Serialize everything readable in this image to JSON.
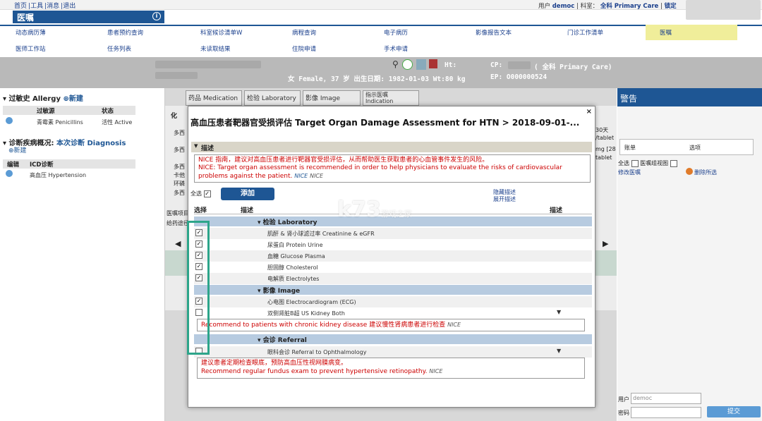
{
  "top": {
    "links": [
      "首页",
      "工具",
      "消息",
      "退出"
    ],
    "user_label": "用户",
    "user": "democ",
    "dept_label": "科室：",
    "dept": "全科 Primary Care",
    "lock": "锁定"
  },
  "app_title": "医嘱",
  "menu": {
    "row1": [
      "动态病历薄",
      "患者预约查询",
      "科室候诊清单W",
      "病程查询",
      "电子病历",
      "影像报告文本",
      "门诊工作清单",
      "医嘱"
    ],
    "row2": [
      "医师工作站",
      "任务列表",
      "未读取结果",
      "住院申请",
      "手术申请"
    ]
  },
  "patient": {
    "ht": "Ht:",
    "cp": "CP:",
    "care": "( 全科 Primary Care)",
    "line2": "女 Female, 37 岁  出生日期: 1982-01-03  Wt:80 kg",
    "ep": "EP: O000000524"
  },
  "left": {
    "allergy_title": "过敏史 Allergy",
    "new": "新建",
    "allergy_cols": [
      "过敏源",
      "状态"
    ],
    "allergy_row": [
      "青霉素 Penicillins",
      "活性 Active"
    ],
    "diag_title": "诊断疾病概况:",
    "diag_title2": "本次诊断 Diagnosis",
    "diag_cols": [
      "编辑",
      "ICD诊断"
    ],
    "diag_row": "高血压 Hypertension"
  },
  "tabs": [
    "药品 Medication",
    "检验 Laboratory",
    "影像 Image",
    "指示医嘱 Indication"
  ],
  "bg_fragments": {
    "a": "多西",
    "b": "医嘱项目",
    "c": "给药途径",
    "d": "卡他",
    "e": "环磷",
    "f": "30天",
    "g": "/tablet",
    "h": "mg [28",
    "i": "tablet",
    "j": "化"
  },
  "modal": {
    "title": "高血压患者靶器官受损评估 Target Organ Damage Assessment for HTN > 2018-09-01-...",
    "close": "×",
    "desc_label": "描述",
    "desc_zh": "NICE 指南，建议对高血压患者进行靶器官受损评估，从而帮助医生获取患者的心血管事件发生的风险。",
    "desc_en": "NICE: Target organ assessment is recommended in order to help physicians to evaluate the risks of cardiovascular problems against the patient.",
    "desc_nice": "NICE",
    "desc_nice2": "NICE",
    "select_all": "全选",
    "add": "添加",
    "hide": "隐藏描述",
    "expand": "展开描述",
    "col_select": "选择",
    "col_desc": "描述",
    "col_desc2": "描述",
    "cat_lab": "检验 Laboratory",
    "lab_items": [
      "肌酐 & 肾小球滤过率 Creatinine & eGFR",
      "尿蛋白 Protein Urine",
      "血糖 Glucose Plasma",
      "胆固醇 Cholesterol",
      "电解质 Electrolytes"
    ],
    "cat_img": "影像 Image",
    "img_items": [
      "心电图 Electrocardiogram (ECG)",
      "双侧肾脏B超 US Kidney Both"
    ],
    "img_note": "Recommend to patients with chronic kidney disease 建议慢性肾病患者进行检查",
    "img_note_nice": "NICE",
    "cat_ref": "会诊 Referral",
    "ref_items": [
      "眼科会诊 Referral to Ophthalmology"
    ],
    "ref_note_zh": "建议患者定期检查眼底，预防高血压性视网膜病变。",
    "ref_note_en": "Recommend regular fundus exam to prevent hypertensive retinopathy.",
    "ref_note_nice": "NICE"
  },
  "right": {
    "title": "警告",
    "cols": [
      "账单",
      "选项"
    ],
    "select_all": "全选",
    "checkbox_label": "医嘱组视图",
    "edit": "修改医嘱",
    "delete": "删除所选",
    "user_label": "用户",
    "user_val": "democ",
    "pwd_label": "密码",
    "submit": "提交"
  },
  "watermark": {
    "main": "k73",
    "sub": "游戏之家"
  }
}
